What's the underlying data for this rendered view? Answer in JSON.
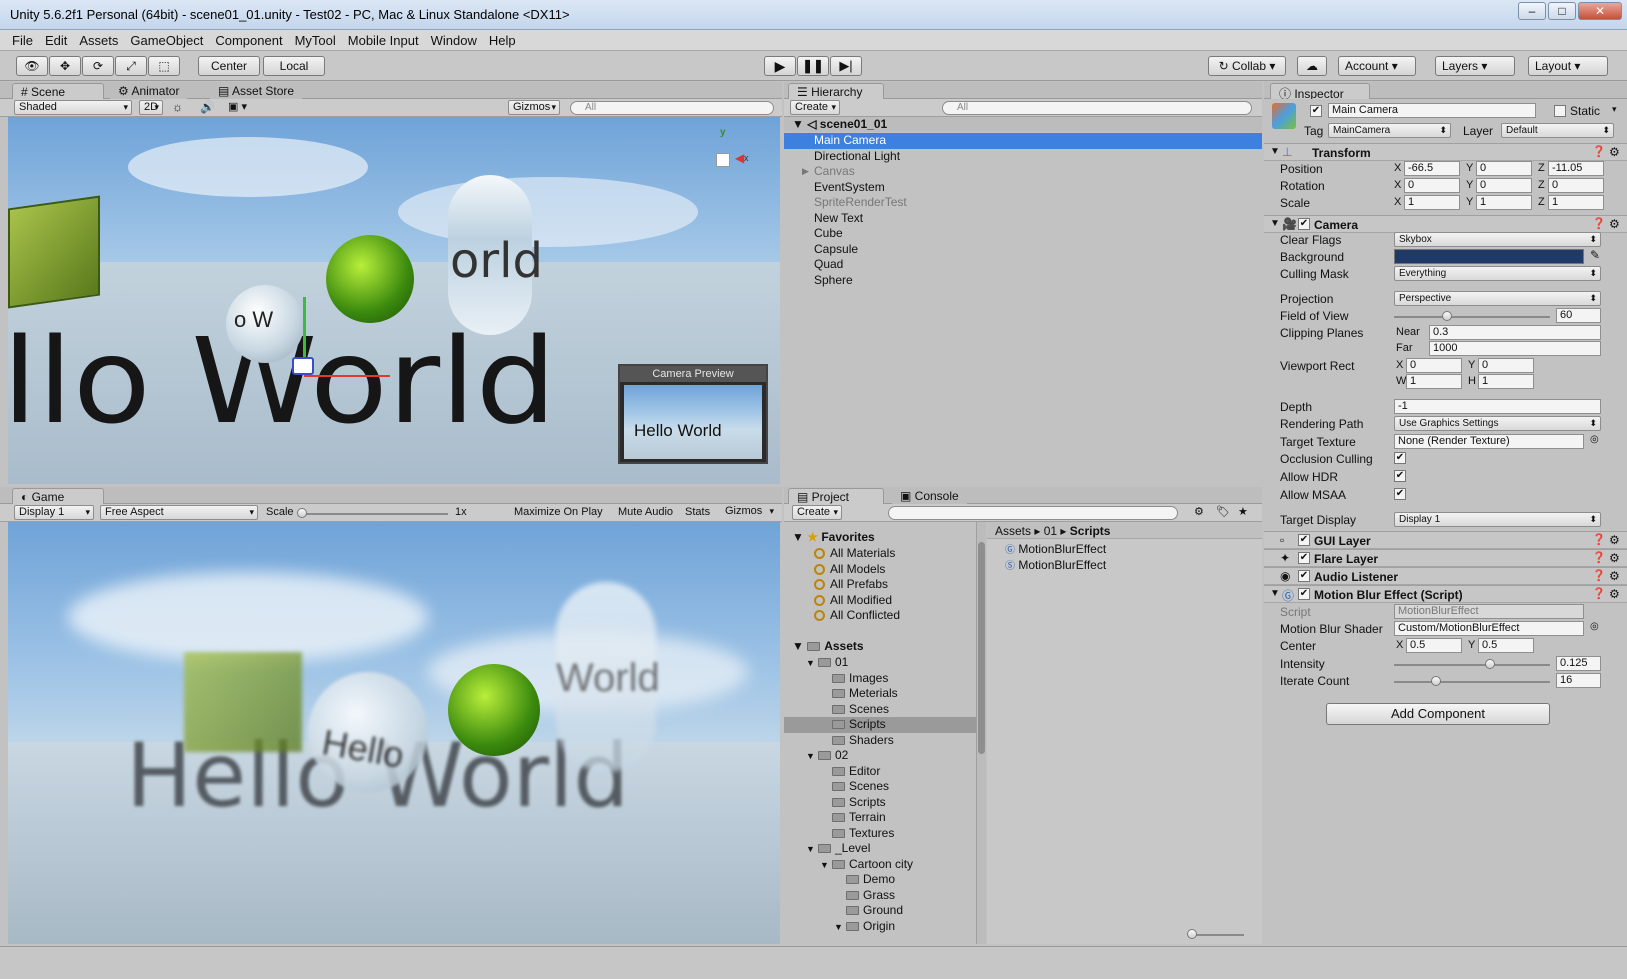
{
  "window": {
    "title": "Unity 5.6.2f1 Personal (64bit) - scene01_01.unity - Test02 - PC, Mac & Linux Standalone <DX11>"
  },
  "menu": [
    "File",
    "Edit",
    "Assets",
    "GameObject",
    "Component",
    "MyTool",
    "Mobile Input",
    "Window",
    "Help"
  ],
  "toolbar": {
    "center": "Center",
    "local": "Local",
    "collab": "Collab",
    "account": "Account",
    "layers": "Layers",
    "layout": "Layout"
  },
  "scene": {
    "tabs": [
      "Scene",
      "Animator",
      "Asset Store"
    ],
    "shading": "Shaded",
    "mode2d": "2D",
    "gizmos": "Gizmos",
    "search": "All",
    "preview_title": "Camera Preview",
    "preview_text": "Hello World",
    "world_text": "llo World",
    "pill_text": "orld",
    "orb_text": "o W"
  },
  "game": {
    "tab": "Game",
    "display": "Display 1",
    "aspect": "Free Aspect",
    "scale_label": "Scale",
    "scale_value": "1x",
    "maximize": "Maximize On Play",
    "mute": "Mute Audio",
    "stats": "Stats",
    "gizmos": "Gizmos",
    "text": "Hello World",
    "orb_text": "Hello",
    "ghost_text": "World"
  },
  "hierarchy": {
    "tab": "Hierarchy",
    "create": "Create",
    "search": "All",
    "scene": "scene01_01",
    "items": [
      "Main Camera",
      "Directional Light",
      "Canvas",
      "EventSystem",
      "SpriteRenderTest",
      "New Text",
      "Cube",
      "Capsule",
      "Quad",
      "Sphere"
    ]
  },
  "project": {
    "tabs": [
      "Project",
      "Console"
    ],
    "create": "Create",
    "favorites_label": "Favorites",
    "favorites": [
      "All Materials",
      "All Models",
      "All Prefabs",
      "All Modified",
      "All Conflicted"
    ],
    "assets_label": "Assets",
    "tree": [
      {
        "label": "01",
        "depth": 1,
        "open": true
      },
      {
        "label": "Images",
        "depth": 2
      },
      {
        "label": "Meterials",
        "depth": 2
      },
      {
        "label": "Scenes",
        "depth": 2
      },
      {
        "label": "Scripts",
        "depth": 2,
        "selected": true
      },
      {
        "label": "Shaders",
        "depth": 2
      },
      {
        "label": "02",
        "depth": 1,
        "open": true
      },
      {
        "label": "Editor",
        "depth": 2
      },
      {
        "label": "Scenes",
        "depth": 2
      },
      {
        "label": "Scripts",
        "depth": 2
      },
      {
        "label": "Terrain",
        "depth": 2
      },
      {
        "label": "Textures",
        "depth": 2
      },
      {
        "label": "_Level",
        "depth": 1,
        "open": true
      },
      {
        "label": "Cartoon city",
        "depth": 2,
        "open": true
      },
      {
        "label": "Demo",
        "depth": 3
      },
      {
        "label": "Grass",
        "depth": 3
      },
      {
        "label": "Ground",
        "depth": 3
      },
      {
        "label": "Origin",
        "depth": 3,
        "open": true
      }
    ],
    "breadcrumb": [
      "Assets",
      "01",
      "Scripts"
    ],
    "files": [
      {
        "name": "MotionBlurEffect",
        "kind": "shader"
      },
      {
        "name": "MotionBlurEffect",
        "kind": "script"
      }
    ]
  },
  "inspector": {
    "tab": "Inspector",
    "object_name": "Main Camera",
    "static_label": "Static",
    "tag_label": "Tag",
    "tag": "MainCamera",
    "layer_label": "Layer",
    "layer": "Default",
    "transform": {
      "title": "Transform",
      "position": {
        "label": "Position",
        "x": "-66.5",
        "y": "0",
        "z": "-11.05"
      },
      "rotation": {
        "label": "Rotation",
        "x": "0",
        "y": "0",
        "z": "0"
      },
      "scale": {
        "label": "Scale",
        "x": "1",
        "y": "1",
        "z": "1"
      }
    },
    "camera": {
      "title": "Camera",
      "clear_flags": {
        "label": "Clear Flags",
        "value": "Skybox"
      },
      "background": {
        "label": "Background",
        "color": "#1f3a66"
      },
      "culling_mask": {
        "label": "Culling Mask",
        "value": "Everything"
      },
      "projection": {
        "label": "Projection",
        "value": "Perspective"
      },
      "fov": {
        "label": "Field of View",
        "value": "60",
        "fraction": 0.33
      },
      "clipping": {
        "label": "Clipping Planes",
        "near_label": "Near",
        "near": "0.3",
        "far_label": "Far",
        "far": "1000"
      },
      "viewport": {
        "label": "Viewport Rect",
        "x": "0",
        "y": "0",
        "w": "1",
        "h": "1"
      },
      "depth": {
        "label": "Depth",
        "value": "-1"
      },
      "rendering_path": {
        "label": "Rendering Path",
        "value": "Use Graphics Settings"
      },
      "target_texture": {
        "label": "Target Texture",
        "value": "None (Render Texture)"
      },
      "occlusion": {
        "label": "Occlusion Culling",
        "checked": true
      },
      "hdr": {
        "label": "Allow HDR",
        "checked": true
      },
      "msaa": {
        "label": "Allow MSAA",
        "checked": true
      },
      "target_display": {
        "label": "Target Display",
        "value": "Display 1"
      }
    },
    "components": [
      "GUI Layer",
      "Flare Layer",
      "Audio Listener"
    ],
    "script": {
      "title": "Motion Blur Effect (Script)",
      "script_label": "Script",
      "script_value": "MotionBlurEffect",
      "shader_label": "Motion Blur Shader",
      "shader_value": "Custom/MotionBlurEffect",
      "center_label": "Center",
      "center_x": "0.5",
      "center_y": "0.5",
      "intensity_label": "Intensity",
      "intensity": "0.125",
      "intensity_fraction": 0.62,
      "iterate_label": "Iterate Count",
      "iterate": "16",
      "iterate_fraction": 0.25
    },
    "add_component": "Add Component"
  },
  "colors": {
    "selection": "#3d80df",
    "panel": "#c2c2c2",
    "header": "#bdbdbd"
  }
}
